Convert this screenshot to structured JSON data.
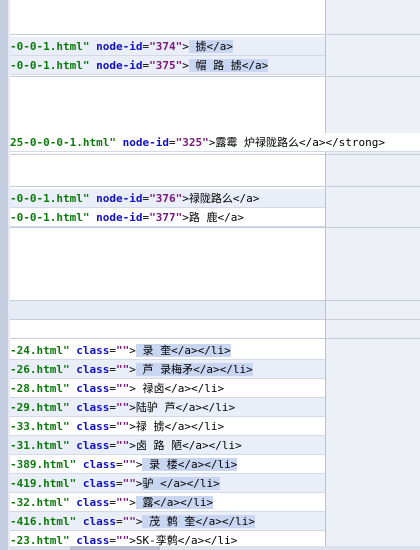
{
  "lines": [
    {
      "id": "374",
      "prefix": "-0-0-1.html\"",
      "attr": "node-id",
      "value": "\"374\"",
      "text": "               掳</a>"
    },
    {
      "id": "375",
      "prefix": "-0-0-1.html\"",
      "attr": "node-id",
      "value": "\"375\"",
      "text": "  帽  路     掳</a>"
    },
    {
      "id": "325",
      "prefix": "25-0-0-0-1.html\"",
      "attr": "node-id",
      "value": "\"325\"",
      "text": "露霉  炉禄陇路么</a></strong>"
    },
    {
      "id": "376",
      "prefix": "-0-0-1.html\"",
      "attr": "node-id",
      "value": "\"376\"",
      "text": "禄陇路么</a>"
    },
    {
      "id": "377",
      "prefix": "-0-0-1.html\"",
      "attr": "node-id",
      "value": "\"377\"",
      "text": "路    鹿</a>"
    }
  ],
  "list_items": [
    {
      "prefix": "-24.html\"",
      "attr": "class",
      "value": "\"\"",
      "text": "  录  奎</a></li>"
    },
    {
      "prefix": "-26.html\"",
      "attr": "class",
      "value": "\"\"",
      "text": "     芦  录梅矛</a></li>"
    },
    {
      "prefix": "-28.html\"",
      "attr": "class",
      "value": "\"\"",
      "text": "  禄卤</a></li>"
    },
    {
      "prefix": "-29.html\"",
      "attr": "class",
      "value": "\"\"",
      "text": "陆驴      芦</a></li>"
    },
    {
      "prefix": "-33.html\"",
      "attr": "class",
      "value": "\"\"",
      "text": "禄  掳</a></li>"
    },
    {
      "prefix": "-31.html\"",
      "attr": "class",
      "value": "\"\"",
      "text": "卤    路  陋</a></li>"
    },
    {
      "prefix": "-389.html\"",
      "attr": "class",
      "value": "\"\"",
      "text": "  录  楼</a></li>"
    },
    {
      "prefix": "-419.html\"",
      "attr": "class",
      "value": "\"\"",
      "text": "驴          </a></li>"
    },
    {
      "prefix": "-32.html\"",
      "attr": "class",
      "value": "\"\"",
      "text": "     露</a></li>"
    },
    {
      "prefix": "-416.html\"",
      "attr": "class",
      "value": "\"\"",
      "text": "  茂  鹩  奎</a></li>"
    },
    {
      "prefix": "-23.html\"",
      "attr": "class",
      "value": "\"\"",
      "text": "SK-孪鹩</a></li>"
    }
  ]
}
